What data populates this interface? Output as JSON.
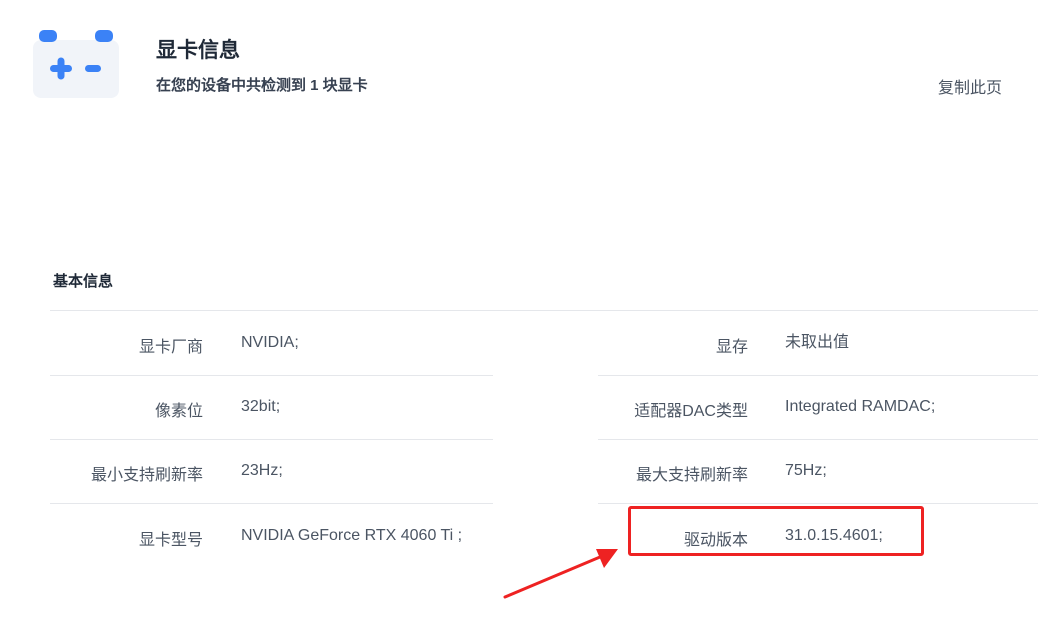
{
  "header": {
    "title": "显卡信息",
    "subtitle": "在您的设备中共检测到 1 块显卡",
    "copy_label": "复制此页",
    "icon": "gpu-card-icon"
  },
  "section": {
    "title": "基本信息"
  },
  "left_fields": [
    {
      "label": "显卡厂商",
      "value": "NVIDIA;"
    },
    {
      "label": "像素位",
      "value": "32bit;"
    },
    {
      "label": "最小支持刷新率",
      "value": "23Hz;"
    },
    {
      "label": "显卡型号",
      "value": "NVIDIA GeForce RTX 4060 Ti ;"
    }
  ],
  "right_fields": [
    {
      "label": "显存",
      "value": "未取出值"
    },
    {
      "label": "适配器DAC类型",
      "value": "Integrated RAMDAC;"
    },
    {
      "label": "最大支持刷新率",
      "value": "75Hz;"
    },
    {
      "label": "驱动版本",
      "value": "31.0.15.4601;"
    }
  ],
  "colors": {
    "accent": "#3b82f6",
    "highlight": "#ee2222"
  }
}
